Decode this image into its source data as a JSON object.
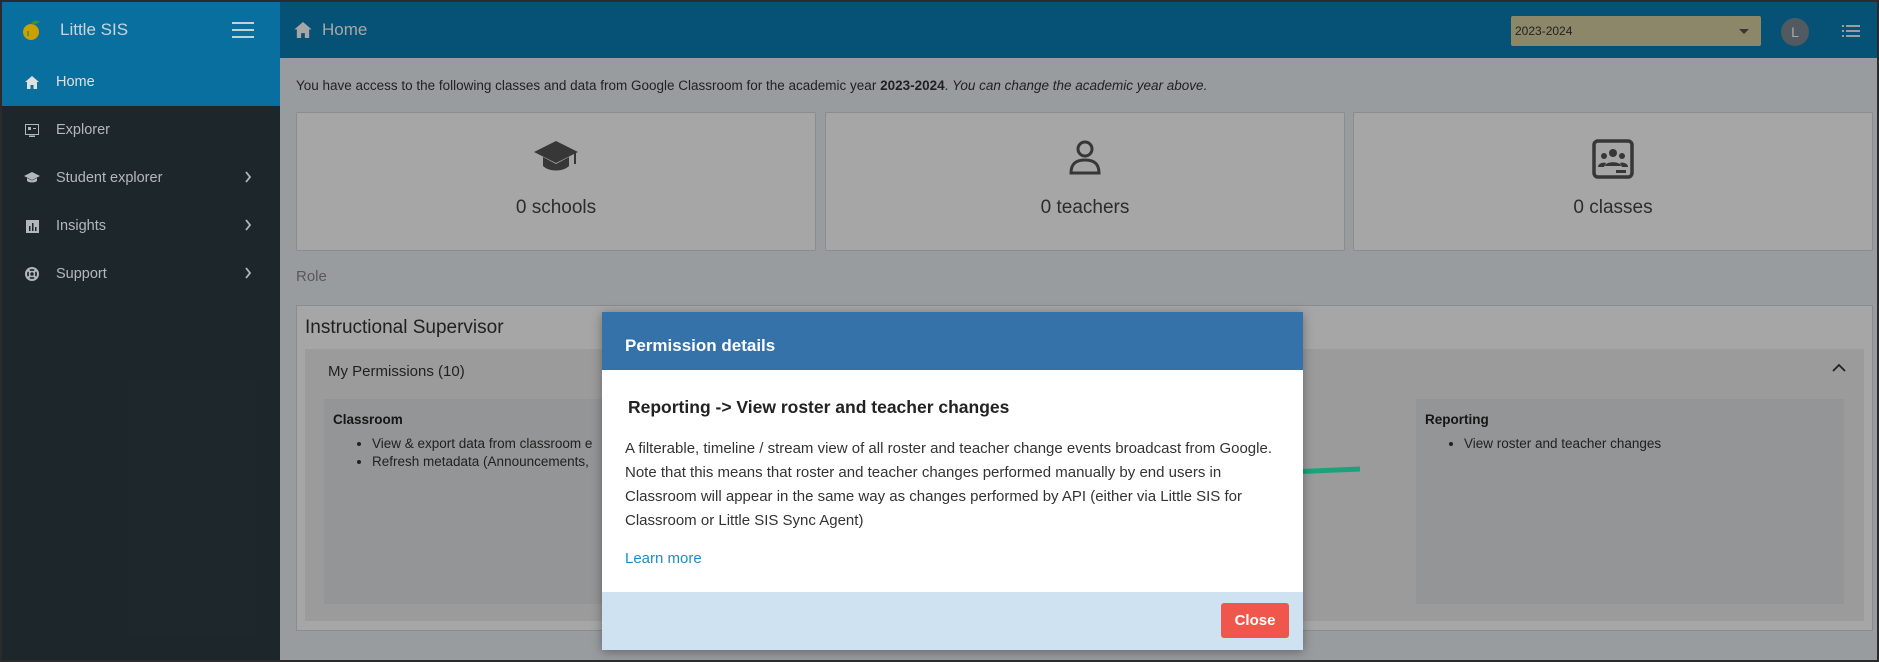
{
  "sidebar": {
    "brand": "Little SIS",
    "items": [
      {
        "label": "Home",
        "icon": "home-icon",
        "active": true
      },
      {
        "label": "Explorer",
        "icon": "explorer-icon"
      },
      {
        "label": "Student explorer",
        "icon": "graduation-cap-icon",
        "chevron": true
      },
      {
        "label": "Insights",
        "icon": "chart-icon",
        "chevron": true
      },
      {
        "label": "Support",
        "icon": "lifebuoy-icon",
        "chevron": true
      }
    ]
  },
  "header": {
    "title": "Home",
    "year_select": "2023-2024",
    "avatar_initial": "L"
  },
  "main": {
    "intro_prefix": "You have access to the following classes and data from Google Classroom for the academic year ",
    "intro_year": "2023-2024",
    "intro_suffix": ". ",
    "intro_note": "You can change the academic year above.",
    "cards": [
      {
        "label": "0 schools",
        "icon": "graduation-cap-icon"
      },
      {
        "label": "0  teachers",
        "icon": "person-icon"
      },
      {
        "label": "0 classes",
        "icon": "classroom-icon"
      }
    ],
    "role_label": "Role",
    "role_title": "Instructional Supervisor",
    "permissions_title": "My Permissions (10)",
    "columns": [
      {
        "title": "Classroom",
        "items": [
          "View & export data from classroom e",
          "Refresh metadata (Announcements,"
        ]
      },
      {
        "title": "Reporting",
        "items": [
          "View roster and teacher changes"
        ]
      }
    ]
  },
  "modal": {
    "title": "Permission details",
    "subtitle": "Reporting -> View roster and teacher changes",
    "description": "A filterable, timeline / stream view of all roster and teacher change events broadcast from Google. Note that this means that roster and teacher changes performed manually by end users in Classroom will appear in the same way as changes performed by API (either via Little SIS for Classroom or Little SIS Sync Agent)",
    "link": "Learn more",
    "close": "Close"
  },
  "colors": {
    "primary": "#0a7fb5",
    "sidebar": "#222d32",
    "modal_header": "#3572a9",
    "close_button": "#f0564c",
    "annotation_arrow": "#1aa37a"
  }
}
